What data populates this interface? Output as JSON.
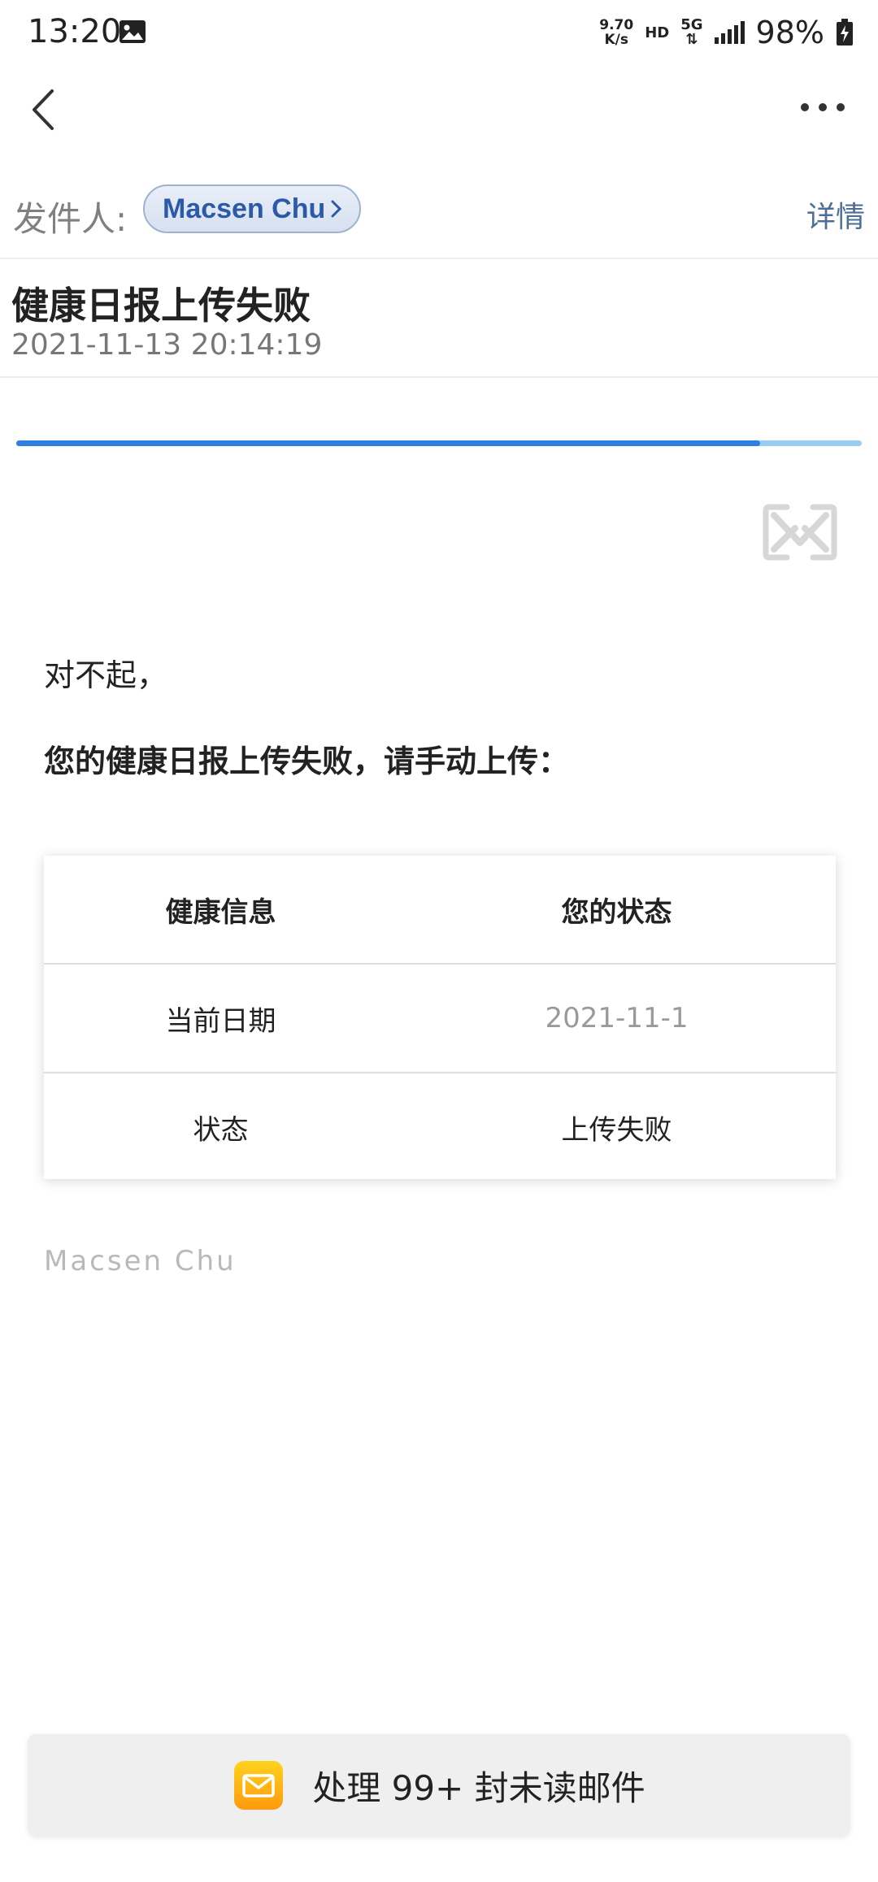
{
  "status_bar": {
    "time": "13:20",
    "speed_value": "9.70",
    "speed_unit": "K/s",
    "hd": "HD",
    "network": "5G",
    "battery": "98%"
  },
  "sender": {
    "label": "发件人:",
    "name": "Macsen Chu",
    "details_link": "详情"
  },
  "email": {
    "subject": "健康日报上传失败",
    "date": "2021-11-13 20:14:19",
    "load_progress": 0.88
  },
  "body": {
    "line1": "对不起，",
    "line2": "您的健康日报上传失败，请手动上传："
  },
  "table": {
    "headers": [
      "健康信息",
      "您的状态"
    ],
    "rows": [
      [
        "当前日期",
        "2021-11-1"
      ],
      [
        "状态",
        "上传失败"
      ]
    ]
  },
  "signature": "Macsen Chu",
  "unread_bar": {
    "label": "处理 99+ 封未读邮件"
  },
  "colors": {
    "accent": "#2f7fe0",
    "chip_text": "#2c5aa8",
    "link": "#4d6e96"
  }
}
